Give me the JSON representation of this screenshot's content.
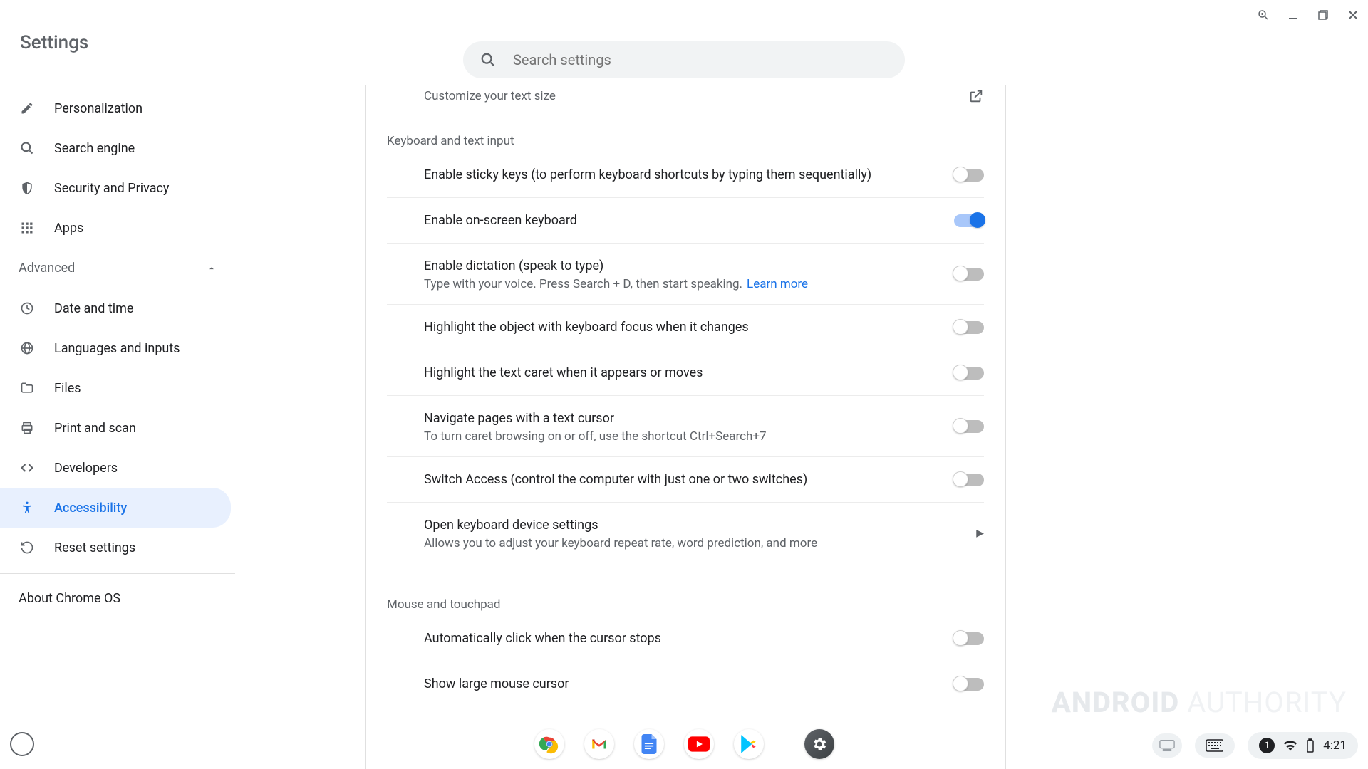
{
  "window": {
    "title": "Settings"
  },
  "search": {
    "placeholder": "Search settings"
  },
  "sidebar": {
    "items": [
      {
        "label": "Personalization",
        "icon": "pencil"
      },
      {
        "label": "Search engine",
        "icon": "search"
      },
      {
        "label": "Security and Privacy",
        "icon": "shield"
      },
      {
        "label": "Apps",
        "icon": "grid"
      }
    ],
    "advanced_label": "Advanced",
    "advanced_items": [
      {
        "label": "Date and time",
        "icon": "clock"
      },
      {
        "label": "Languages and inputs",
        "icon": "globe"
      },
      {
        "label": "Files",
        "icon": "folder"
      },
      {
        "label": "Print and scan",
        "icon": "printer"
      },
      {
        "label": "Developers",
        "icon": "code"
      },
      {
        "label": "Accessibility",
        "icon": "a11y",
        "active": true
      },
      {
        "label": "Reset settings",
        "icon": "reset"
      }
    ],
    "about_label": "About Chrome OS"
  },
  "content": {
    "top_row_sub": "Customize your text size",
    "section1": {
      "title": "Keyboard and text input",
      "rows": [
        {
          "label": "Enable sticky keys (to perform keyboard shortcuts by typing them sequentially)",
          "on": false
        },
        {
          "label": "Enable on-screen keyboard",
          "on": true
        },
        {
          "label": "Enable dictation (speak to type)",
          "sub": "Type with your voice. Press Search + D, then start speaking.",
          "learn": "Learn more",
          "on": false
        },
        {
          "label": "Highlight the object with keyboard focus when it changes",
          "on": false
        },
        {
          "label": "Highlight the text caret when it appears or moves",
          "on": false
        },
        {
          "label": "Navigate pages with a text cursor",
          "sub": "To turn caret browsing on or off, use the shortcut Ctrl+Search+7",
          "on": false
        },
        {
          "label": "Switch Access (control the computer with just one or two switches)",
          "on": false
        },
        {
          "label": "Open keyboard device settings",
          "sub": "Allows you to adjust your keyboard repeat rate, word prediction, and more",
          "arrow": true
        }
      ]
    },
    "section2": {
      "title": "Mouse and touchpad",
      "rows": [
        {
          "label": "Automatically click when the cursor stops",
          "on": false
        },
        {
          "label": "Show large mouse cursor",
          "on": false
        }
      ]
    }
  },
  "tray": {
    "badge": "1",
    "time": "4:21"
  },
  "watermark": {
    "a": "ANDROID",
    "b": "AUTHORITY"
  }
}
